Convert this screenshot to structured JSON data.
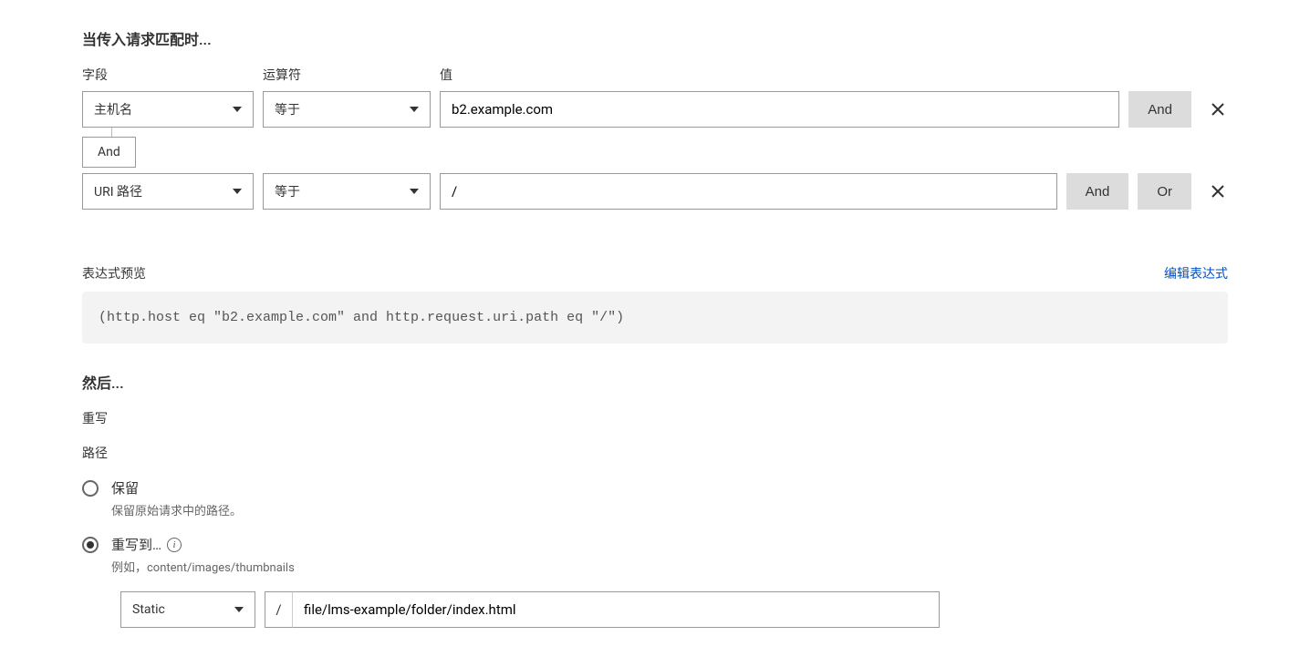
{
  "match_section_title": "当传入请求匹配时...",
  "labels": {
    "field": "字段",
    "operator": "运算符",
    "value": "值"
  },
  "conditions": [
    {
      "field": "主机名",
      "operator": "等于",
      "value": "b2.example.com",
      "buttons": [
        "And"
      ]
    },
    {
      "field": "URI 路径",
      "operator": "等于",
      "value": "/",
      "buttons": [
        "And",
        "Or"
      ]
    }
  ],
  "connector": "And",
  "preview": {
    "label": "表达式预览",
    "edit_link": "编辑表达式",
    "expression": "(http.host eq \"b2.example.com\" and http.request.uri.path eq \"/\")"
  },
  "then_title": "然后...",
  "rewrite_label": "重写",
  "path_label": "路径",
  "path_options": {
    "preserve": {
      "title": "保留",
      "sub": "保留原始请求中的路径。"
    },
    "rewrite": {
      "title": "重写到…",
      "sub": "例如，content/images/thumbnails"
    }
  },
  "rewrite_config": {
    "type": "Static",
    "slash": "/",
    "value": "file/lms-example/folder/index.html"
  }
}
